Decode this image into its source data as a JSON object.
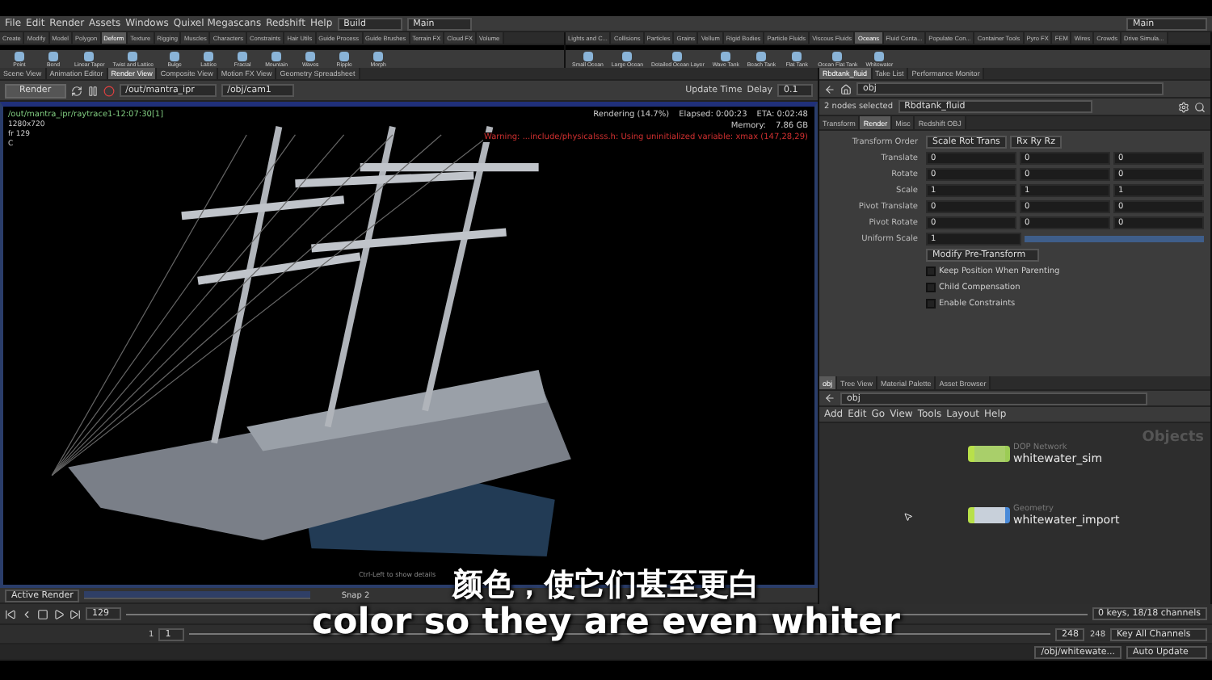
{
  "menu_bar": {
    "items": [
      "File",
      "Edit",
      "Render",
      "Assets",
      "Windows",
      "Quixel Megascans",
      "Redshift",
      "Help"
    ],
    "desktop": "Build",
    "layout": "Main",
    "right_layout": "Main"
  },
  "shelf_left": {
    "tabs": [
      {
        "label": "Create",
        "selected": false
      },
      {
        "label": "Modify",
        "selected": false
      },
      {
        "label": "Model",
        "selected": false
      },
      {
        "label": "Polygon",
        "selected": false
      },
      {
        "label": "Deform",
        "selected": true
      },
      {
        "label": "Texture",
        "selected": false
      },
      {
        "label": "Rigging",
        "selected": false
      },
      {
        "label": "Muscles",
        "selected": false
      },
      {
        "label": "Characters",
        "selected": false
      },
      {
        "label": "Constraints",
        "selected": false
      },
      {
        "label": "Hair Utils",
        "selected": false
      },
      {
        "label": "Guide Process",
        "selected": false
      },
      {
        "label": "Guide Brushes",
        "selected": false
      },
      {
        "label": "Terrain FX",
        "selected": false
      },
      {
        "label": "Cloud FX",
        "selected": false
      },
      {
        "label": "Volume",
        "selected": false
      }
    ],
    "tools": [
      "Point",
      "Bend",
      "Linear Taper",
      "Twist and Lattice",
      "Bulge",
      "Lattice",
      "Fractal",
      "Mountain",
      "Waves",
      "Ripple",
      "Morph"
    ]
  },
  "shelf_right": {
    "tabs": [
      {
        "label": "Lights and C...",
        "selected": false
      },
      {
        "label": "Collisions",
        "selected": false
      },
      {
        "label": "Particles",
        "selected": false
      },
      {
        "label": "Grains",
        "selected": false
      },
      {
        "label": "Vellum",
        "selected": false
      },
      {
        "label": "Rigid Bodies",
        "selected": false
      },
      {
        "label": "Particle Fluids",
        "selected": false
      },
      {
        "label": "Viscous Fluids",
        "selected": false
      },
      {
        "label": "Oceans",
        "selected": true
      },
      {
        "label": "Fluid Conta...",
        "selected": false
      },
      {
        "label": "Populate Con...",
        "selected": false
      },
      {
        "label": "Container Tools",
        "selected": false
      },
      {
        "label": "Pyro FX",
        "selected": false
      },
      {
        "label": "FEM",
        "selected": false
      },
      {
        "label": "Wires",
        "selected": false
      },
      {
        "label": "Crowds",
        "selected": false
      },
      {
        "label": "Drive Simula...",
        "selected": false
      }
    ],
    "tools": [
      "Small Ocean",
      "Large Ocean",
      "Detailed Ocean Layer",
      "Wave Tank",
      "Beach Tank",
      "Flat Tank",
      "Ocean Flat Tank",
      "Whitewater"
    ]
  },
  "viewer": {
    "tabs": [
      {
        "label": "Scene View",
        "selected": false
      },
      {
        "label": "Animation Editor",
        "selected": false
      },
      {
        "label": "Render View",
        "selected": true
      },
      {
        "label": "Composite View",
        "selected": false
      },
      {
        "label": "Motion FX View",
        "selected": false
      },
      {
        "label": "Geometry Spreadsheet",
        "selected": false
      }
    ],
    "render_button": "Render",
    "renderer": "/out/mantra_ipr",
    "camera": "/obj/cam1",
    "update_time": "Update Time",
    "delay_label": "Delay",
    "delay": "0.1",
    "overlay": {
      "path": "/out/mantra_ipr/raytrace1-12:07:30[1]",
      "resolution": "1280x720",
      "frame": "fr 129",
      "channel": "C",
      "status": "Rendering (14.7%)",
      "elapsed": "Elapsed: 0:00:23",
      "eta": "ETA: 0:02:48",
      "memory_label": "Memory:",
      "memory": "7.86 GB",
      "warning": "Warning: ...include/physicalsss.h: Using uninitialized variable: xmax (147,28,29)"
    },
    "hint": "Ctrl-Left to show details",
    "render_select": "Active Render",
    "snap": "Snap 2"
  },
  "parameters": {
    "tabs": [
      {
        "label": "Rbdtank_fluid",
        "selected": true
      },
      {
        "label": "Take List",
        "selected": false
      },
      {
        "label": "Performance Monitor",
        "selected": false
      }
    ],
    "path": "obj",
    "selection": "2 nodes selected",
    "node_name": "Rbdtank_fluid",
    "param_tabs": [
      {
        "label": "Transform",
        "selected": false
      },
      {
        "label": "Render",
        "selected": true
      },
      {
        "label": "Misc",
        "selected": false
      },
      {
        "label": "Redshift OBJ",
        "selected": false
      }
    ],
    "transform_order": {
      "label": "Transform Order",
      "values": [
        "Scale Rot Trans",
        "Rx Ry Rz"
      ]
    },
    "rows": [
      {
        "label": "Translate",
        "values": [
          "0",
          "0",
          "0"
        ]
      },
      {
        "label": "Rotate",
        "values": [
          "0",
          "0",
          "0"
        ]
      },
      {
        "label": "Scale",
        "values": [
          "1",
          "1",
          "1"
        ]
      },
      {
        "label": "Pivot Translate",
        "values": [
          "0",
          "0",
          "0"
        ]
      },
      {
        "label": "Pivot Rotate",
        "values": [
          "0",
          "0",
          "0"
        ]
      }
    ],
    "uniform_scale": {
      "label": "Uniform Scale",
      "value": "1",
      "level": 1
    },
    "pre_transform": "Modify Pre-Transform",
    "options": [
      {
        "label": "Keep Position When Parenting",
        "checked": false
      },
      {
        "label": "Child Compensation",
        "checked": false
      },
      {
        "label": "Enable Constraints",
        "checked": false
      }
    ]
  },
  "network": {
    "tabs": [
      {
        "label": "obj",
        "selected": true
      },
      {
        "label": "Tree View",
        "selected": false
      },
      {
        "label": "Material Palette",
        "selected": false
      },
      {
        "label": "Asset Browser",
        "selected": false
      }
    ],
    "path": "obj",
    "menu": [
      "Add",
      "Edit",
      "Go",
      "View",
      "Tools",
      "Layout",
      "Help"
    ],
    "context": "Objects",
    "nodes": [
      {
        "kind": "dop",
        "type": "DOP Network",
        "name": "whitewater_sim"
      },
      {
        "kind": "geo",
        "type": "Geometry",
        "name": "whitewater_import"
      }
    ]
  },
  "timeline": {
    "frame": "129",
    "start": "1",
    "range_start": "1",
    "range_end": "248",
    "end": "248",
    "keys": "0 keys, 18/18 channels",
    "key_all": "Key All Channels"
  },
  "status_bar": {
    "path": "/obj/whitewate...",
    "update_mode": "Auto Update"
  },
  "subtitles": [
    "颜色，使它们甚至更白",
    "color so they are even whiter"
  ]
}
